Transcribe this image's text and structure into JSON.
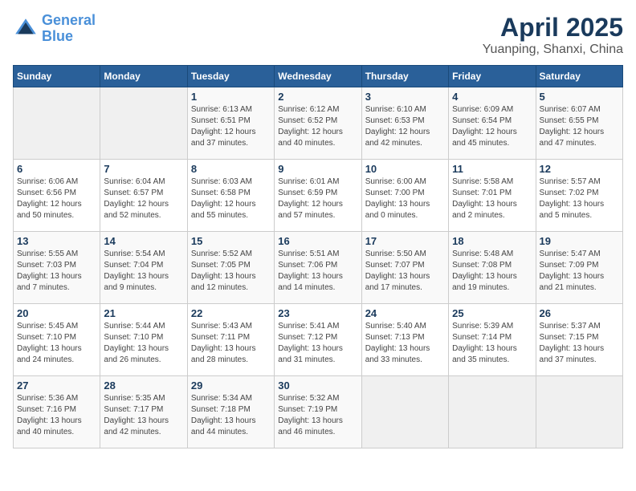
{
  "header": {
    "logo_line1": "General",
    "logo_line2": "Blue",
    "title": "April 2025",
    "subtitle": "Yuanping, Shanxi, China"
  },
  "days_of_week": [
    "Sunday",
    "Monday",
    "Tuesday",
    "Wednesday",
    "Thursday",
    "Friday",
    "Saturday"
  ],
  "weeks": [
    [
      {
        "day": "",
        "info": ""
      },
      {
        "day": "",
        "info": ""
      },
      {
        "day": "1",
        "info": "Sunrise: 6:13 AM\nSunset: 6:51 PM\nDaylight: 12 hours\nand 37 minutes."
      },
      {
        "day": "2",
        "info": "Sunrise: 6:12 AM\nSunset: 6:52 PM\nDaylight: 12 hours\nand 40 minutes."
      },
      {
        "day": "3",
        "info": "Sunrise: 6:10 AM\nSunset: 6:53 PM\nDaylight: 12 hours\nand 42 minutes."
      },
      {
        "day": "4",
        "info": "Sunrise: 6:09 AM\nSunset: 6:54 PM\nDaylight: 12 hours\nand 45 minutes."
      },
      {
        "day": "5",
        "info": "Sunrise: 6:07 AM\nSunset: 6:55 PM\nDaylight: 12 hours\nand 47 minutes."
      }
    ],
    [
      {
        "day": "6",
        "info": "Sunrise: 6:06 AM\nSunset: 6:56 PM\nDaylight: 12 hours\nand 50 minutes."
      },
      {
        "day": "7",
        "info": "Sunrise: 6:04 AM\nSunset: 6:57 PM\nDaylight: 12 hours\nand 52 minutes."
      },
      {
        "day": "8",
        "info": "Sunrise: 6:03 AM\nSunset: 6:58 PM\nDaylight: 12 hours\nand 55 minutes."
      },
      {
        "day": "9",
        "info": "Sunrise: 6:01 AM\nSunset: 6:59 PM\nDaylight: 12 hours\nand 57 minutes."
      },
      {
        "day": "10",
        "info": "Sunrise: 6:00 AM\nSunset: 7:00 PM\nDaylight: 13 hours\nand 0 minutes."
      },
      {
        "day": "11",
        "info": "Sunrise: 5:58 AM\nSunset: 7:01 PM\nDaylight: 13 hours\nand 2 minutes."
      },
      {
        "day": "12",
        "info": "Sunrise: 5:57 AM\nSunset: 7:02 PM\nDaylight: 13 hours\nand 5 minutes."
      }
    ],
    [
      {
        "day": "13",
        "info": "Sunrise: 5:55 AM\nSunset: 7:03 PM\nDaylight: 13 hours\nand 7 minutes."
      },
      {
        "day": "14",
        "info": "Sunrise: 5:54 AM\nSunset: 7:04 PM\nDaylight: 13 hours\nand 9 minutes."
      },
      {
        "day": "15",
        "info": "Sunrise: 5:52 AM\nSunset: 7:05 PM\nDaylight: 13 hours\nand 12 minutes."
      },
      {
        "day": "16",
        "info": "Sunrise: 5:51 AM\nSunset: 7:06 PM\nDaylight: 13 hours\nand 14 minutes."
      },
      {
        "day": "17",
        "info": "Sunrise: 5:50 AM\nSunset: 7:07 PM\nDaylight: 13 hours\nand 17 minutes."
      },
      {
        "day": "18",
        "info": "Sunrise: 5:48 AM\nSunset: 7:08 PM\nDaylight: 13 hours\nand 19 minutes."
      },
      {
        "day": "19",
        "info": "Sunrise: 5:47 AM\nSunset: 7:09 PM\nDaylight: 13 hours\nand 21 minutes."
      }
    ],
    [
      {
        "day": "20",
        "info": "Sunrise: 5:45 AM\nSunset: 7:10 PM\nDaylight: 13 hours\nand 24 minutes."
      },
      {
        "day": "21",
        "info": "Sunrise: 5:44 AM\nSunset: 7:10 PM\nDaylight: 13 hours\nand 26 minutes."
      },
      {
        "day": "22",
        "info": "Sunrise: 5:43 AM\nSunset: 7:11 PM\nDaylight: 13 hours\nand 28 minutes."
      },
      {
        "day": "23",
        "info": "Sunrise: 5:41 AM\nSunset: 7:12 PM\nDaylight: 13 hours\nand 31 minutes."
      },
      {
        "day": "24",
        "info": "Sunrise: 5:40 AM\nSunset: 7:13 PM\nDaylight: 13 hours\nand 33 minutes."
      },
      {
        "day": "25",
        "info": "Sunrise: 5:39 AM\nSunset: 7:14 PM\nDaylight: 13 hours\nand 35 minutes."
      },
      {
        "day": "26",
        "info": "Sunrise: 5:37 AM\nSunset: 7:15 PM\nDaylight: 13 hours\nand 37 minutes."
      }
    ],
    [
      {
        "day": "27",
        "info": "Sunrise: 5:36 AM\nSunset: 7:16 PM\nDaylight: 13 hours\nand 40 minutes."
      },
      {
        "day": "28",
        "info": "Sunrise: 5:35 AM\nSunset: 7:17 PM\nDaylight: 13 hours\nand 42 minutes."
      },
      {
        "day": "29",
        "info": "Sunrise: 5:34 AM\nSunset: 7:18 PM\nDaylight: 13 hours\nand 44 minutes."
      },
      {
        "day": "30",
        "info": "Sunrise: 5:32 AM\nSunset: 7:19 PM\nDaylight: 13 hours\nand 46 minutes."
      },
      {
        "day": "",
        "info": ""
      },
      {
        "day": "",
        "info": ""
      },
      {
        "day": "",
        "info": ""
      }
    ]
  ]
}
